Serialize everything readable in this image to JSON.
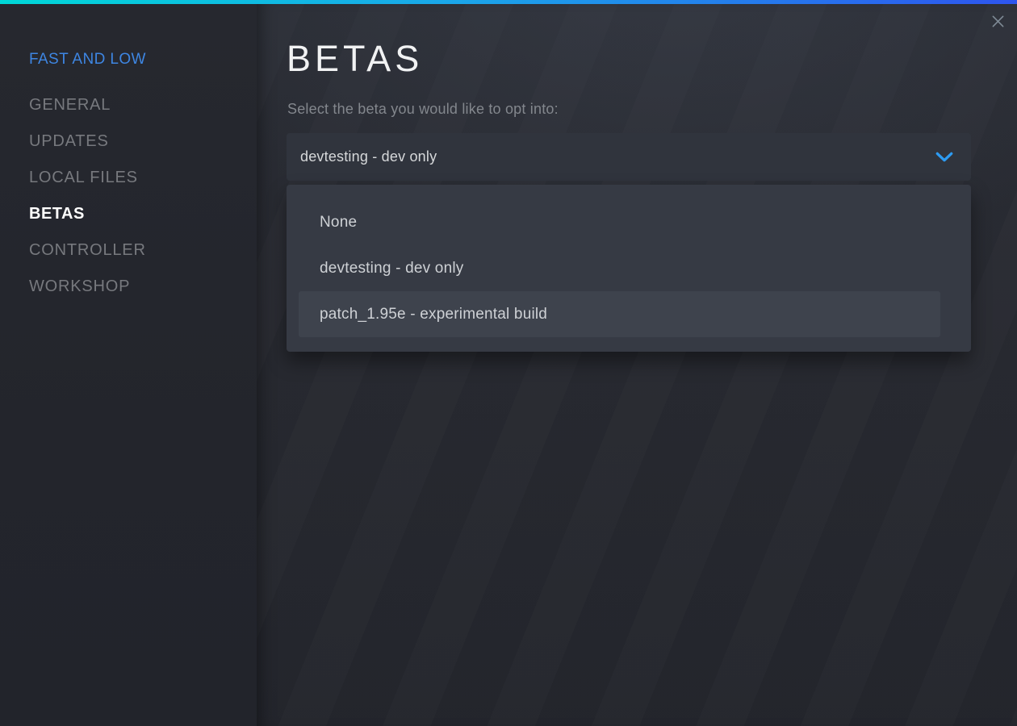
{
  "window": {
    "close_icon": "✕"
  },
  "sidebar": {
    "game_title": "FAST AND LOW",
    "items": [
      {
        "label": "GENERAL",
        "active": false
      },
      {
        "label": "UPDATES",
        "active": false
      },
      {
        "label": "LOCAL FILES",
        "active": false
      },
      {
        "label": "BETAS",
        "active": true
      },
      {
        "label": "CONTROLLER",
        "active": false
      },
      {
        "label": "WORKSHOP",
        "active": false
      }
    ]
  },
  "main": {
    "title": "BETAS",
    "subtitle": "Select the beta you would like to opt into:",
    "select": {
      "value": "devtesting - dev only",
      "chevron_icon": "chevron-down"
    },
    "dropdown": {
      "options": [
        {
          "label": "None",
          "highlighted": false
        },
        {
          "label": "devtesting - dev only",
          "highlighted": false
        },
        {
          "label": "patch_1.95e - experimental build",
          "highlighted": true
        }
      ]
    }
  },
  "colors": {
    "accent_blue": "#2d9bf2",
    "link_blue": "#3e86e2",
    "topbar_gradient_start": "#00d8d8",
    "topbar_gradient_mid": "#1ba6ea",
    "topbar_gradient_end": "#2e55ef",
    "sidebar_bg": "#24262e",
    "main_bg": "#282a31",
    "select_bg": "#30343d",
    "dropdown_bg": "#363a44",
    "highlight_bg": "#3e434d"
  }
}
